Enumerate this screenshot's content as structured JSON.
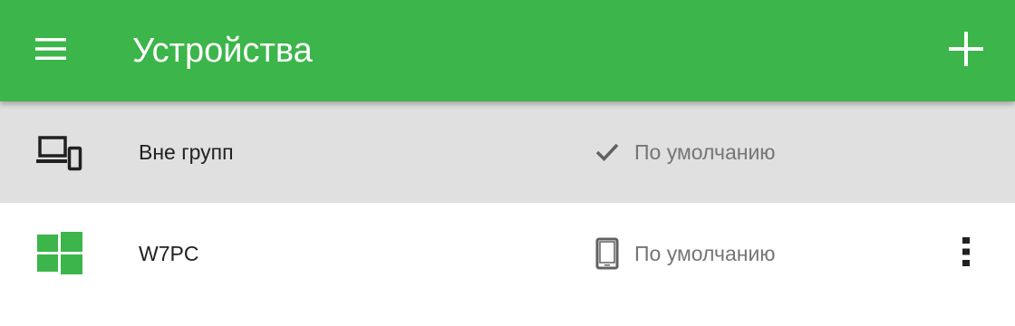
{
  "appbar": {
    "title": "Устройства",
    "menu_icon": "hamburger-menu-icon",
    "add_icon": "plus-icon",
    "color": "#3cb54a"
  },
  "group_row": {
    "icon": "devices-icon",
    "name": "Вне групп",
    "status_icon": "checkmark-icon",
    "status_text": "По умолчанию",
    "background": "#e0e0e0"
  },
  "device_row": {
    "icon": "windows-logo-icon",
    "name": "W7PC",
    "status_icon": "tablet-icon",
    "status_text": "По умолчанию",
    "more_icon": "more-vertical-icon"
  }
}
